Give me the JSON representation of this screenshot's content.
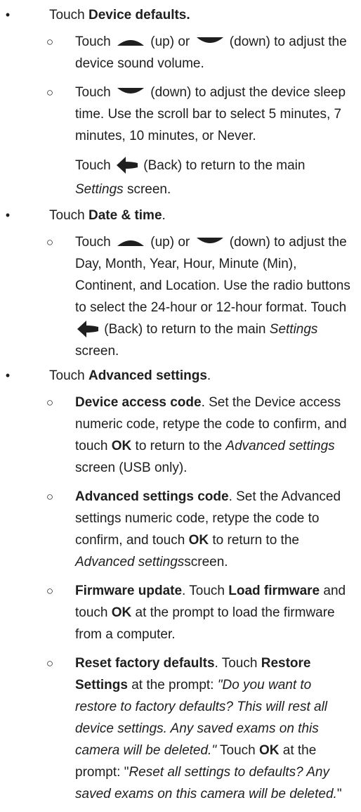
{
  "sections": [
    {
      "touch": "Touch",
      "target": "Device defaults.",
      "items": [
        {
          "t1": "Touch",
          "up": "(up) or",
          "down": "(down) to adjust the device sound volume."
        },
        {
          "t1": "Touch",
          "down": "(down) to adjust the device sleep time. Use the scroll bar to select 5 minutes, 7 minutes, 10 minutes, or Never.",
          "back_pre": "Touch",
          "back": "(Back) to return to the main",
          "back_screen": "Settings",
          "back_post": "screen."
        }
      ]
    },
    {
      "touch": "Touch",
      "target": "Date & time",
      "period": ".",
      "items": [
        {
          "t1": "Touch",
          "up": "(up) or",
          "down": "(down) to adjust the Day, Month, Year, Hour, Minute (Min), Continent, and Location. Use the radio buttons to select the 24-hour or 12-hour format. Touch",
          "back": "(Back) to return to the main",
          "back_screen": "Settings",
          "back_post": "screen."
        }
      ]
    },
    {
      "touch": "Touch",
      "target": "Advanced settings",
      "period": ".",
      "items": [
        {
          "title": "Device access code",
          "text1": ". Set the Device access numeric code, retype the code to confirm, and touch",
          "ok": "OK",
          "text2": "to return to the",
          "screen": "Advanced settings",
          "text3": "screen (USB only)."
        },
        {
          "title": "Advanced settings code",
          "text1": ". Set the Advanced settings numeric code, retype the code to confirm, and touch",
          "ok": "OK",
          "text2": "to return to the",
          "screen": "Advanced settings",
          "text3": "screen."
        },
        {
          "title": "Firmware update",
          "text1": ". Touch",
          "btn": "Load firmware",
          "text2": "and touch",
          "ok": "OK",
          "text3": "at the prompt to load the firmware from a computer."
        },
        {
          "title": "Reset factory defaults",
          "text1": ". Touch",
          "btn": "Restore Settings",
          "text2": "at the prompt:",
          "prompt1": "\"Do you want to restore to factory defaults? This will rest all device settings. Any saved exams on this camera will be deleted.\"",
          "text3": "Touch",
          "ok": "OK",
          "text4": "at the prompt: \"",
          "prompt2": "Reset all settings to defaults? Any saved exams on this camera will be deleted.",
          "text5": "\""
        }
      ]
    }
  ],
  "markers": {
    "bullet": "•",
    "sub": "○"
  },
  "icons": {
    "up": "up-arrow-icon",
    "down": "down-arrow-icon",
    "back": "back-arrow-icon",
    "color": "#1f1f1f"
  }
}
